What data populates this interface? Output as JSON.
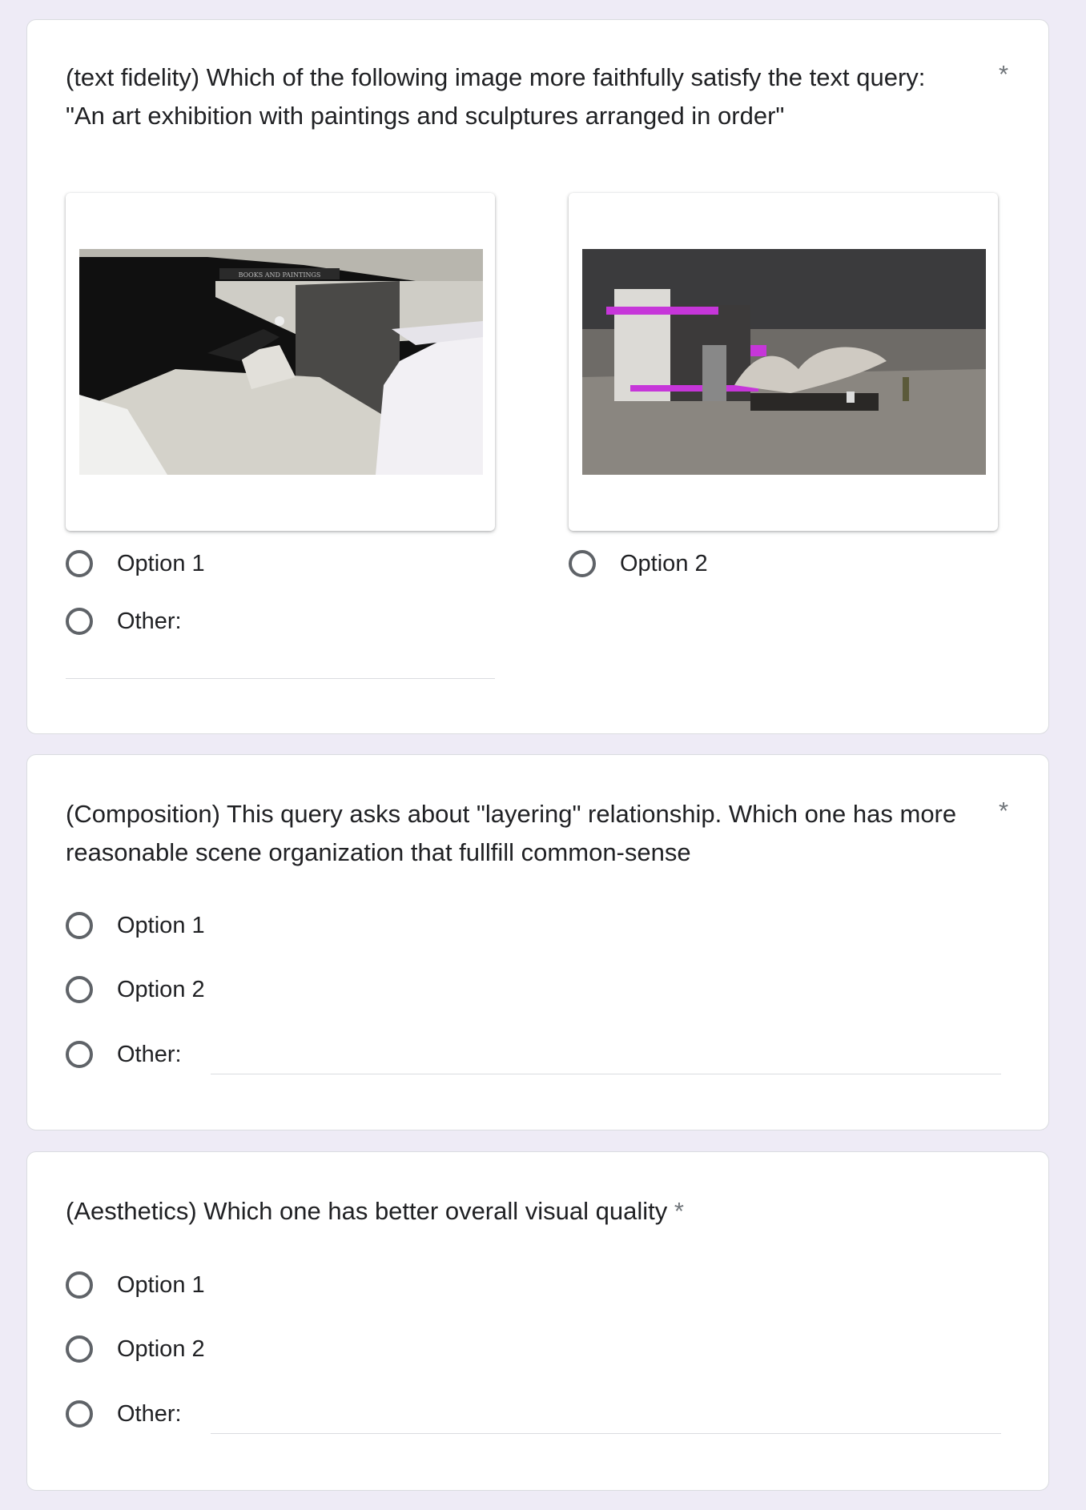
{
  "required_marker": "*",
  "q1": {
    "title_line1": "(text fidelity) Which of the following image more faithfully satisfy the text query:",
    "title_line2": "\"An art exhibition with paintings and sculptures arranged in order\"",
    "image1_caption": "BOOKS AND PAINTINGS",
    "option1": "Option 1",
    "option2": "Option 2",
    "other": "Other:"
  },
  "q2": {
    "title_line1": "(Composition) This query asks about \"layering\"  relationship. Which one has more",
    "title_line2": "reasonable scene organization that fullfill common-sense",
    "option1": "Option 1",
    "option2": "Option 2",
    "other": "Other:"
  },
  "q3": {
    "title": "(Aesthetics) Which one has better overall visual quality",
    "option1": "Option 1",
    "option2": "Option 2",
    "other": "Other:"
  },
  "colors": {
    "background": "#eeebf6",
    "card": "#ffffff",
    "radio_border": "#5f6368",
    "required": "#70757a"
  }
}
